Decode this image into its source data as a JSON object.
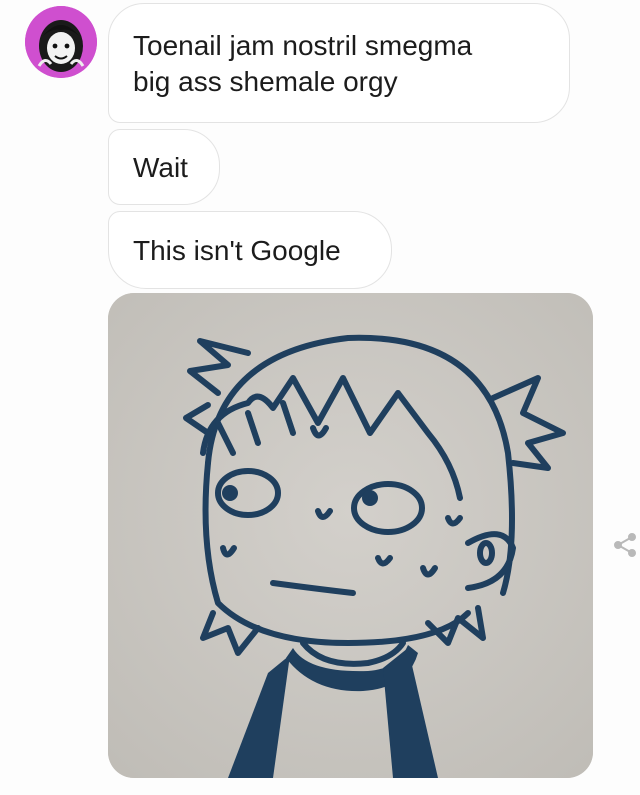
{
  "messages": [
    {
      "type": "text",
      "lines": [
        "Toenail jam nostril smegma",
        "big ass shemale orgy"
      ]
    },
    {
      "type": "text",
      "lines": [
        "Wait"
      ]
    },
    {
      "type": "text",
      "lines": [
        "This isn't Google"
      ]
    },
    {
      "type": "image",
      "subject": "hand-drawn cartoon character with a worried face"
    }
  ],
  "icons": {
    "avatar": "profile-avatar",
    "share": "share-icon"
  },
  "colors": {
    "avatar_bg": "#cf4fcf",
    "bubble_bg": "#ffffff",
    "bubble_border": "#e3e3e3",
    "text": "#1c1c1c",
    "drawing_ink": "#1f3f5e",
    "paper": "#c8c5c0"
  }
}
